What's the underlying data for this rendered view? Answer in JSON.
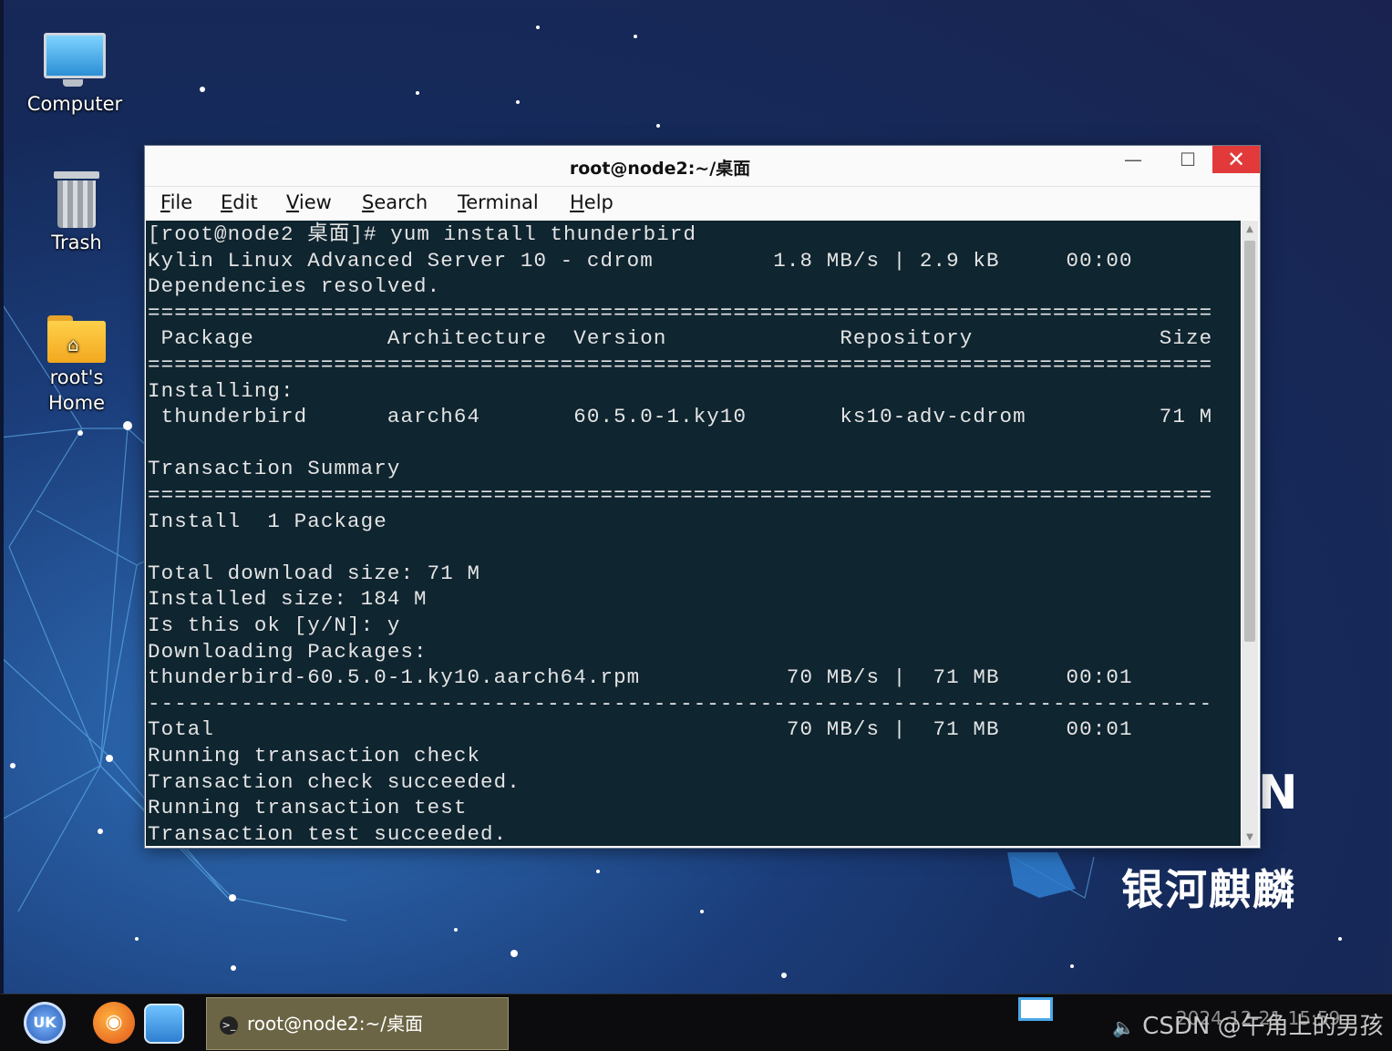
{
  "desktop": {
    "icons": [
      {
        "label": "Computer"
      },
      {
        "label": "Trash"
      },
      {
        "label_line1": "root's",
        "label_line2": "Home"
      }
    ],
    "brand_text": "银河麒麟",
    "brand_partial": "N"
  },
  "window": {
    "title": "root@node2:~/桌面",
    "controls": {
      "minimize": "—",
      "maximize": "☐",
      "close": "✕"
    },
    "menu": [
      {
        "mnemonic": "F",
        "rest": "ile"
      },
      {
        "mnemonic": "E",
        "rest": "dit"
      },
      {
        "mnemonic": "V",
        "rest": "iew"
      },
      {
        "mnemonic": "S",
        "rest": "earch"
      },
      {
        "mnemonic": "T",
        "rest": "erminal"
      },
      {
        "mnemonic": "H",
        "rest": "elp"
      }
    ]
  },
  "terminal": {
    "lines": [
      "[root@node2 桌面]# yum install thunderbird",
      "Kylin Linux Advanced Server 10 - cdrom         1.8 MB/s | 2.9 kB     00:00",
      "Dependencies resolved.",
      "================================================================================",
      " Package          Architecture  Version             Repository              Size",
      "================================================================================",
      "Installing:",
      " thunderbird      aarch64       60.5.0-1.ky10       ks10-adv-cdrom          71 M",
      "",
      "Transaction Summary",
      "================================================================================",
      "Install  1 Package",
      "",
      "Total download size: 71 M",
      "Installed size: 184 M",
      "Is this ok [y/N]: y",
      "Downloading Packages:",
      "thunderbird-60.5.0-1.ky10.aarch64.rpm           70 MB/s |  71 MB     00:01",
      "--------------------------------------------------------------------------------",
      "Total                                           70 MB/s |  71 MB     00:01",
      "Running transaction check",
      "Transaction check succeeded.",
      "Running transaction test",
      "Transaction test succeeded."
    ]
  },
  "taskbar": {
    "start_label": "UK",
    "task_label": "root@node2:~/桌面",
    "tray_text": "CSDN @午角上的男孩",
    "clock_text": "2024-12-21 15:59"
  },
  "colors": {
    "terminal_bg": "#0f2530",
    "terminal_fg": "#e4e4e4",
    "close_button": "#e23a3a",
    "taskbar_bg": "#0c0c0e"
  }
}
